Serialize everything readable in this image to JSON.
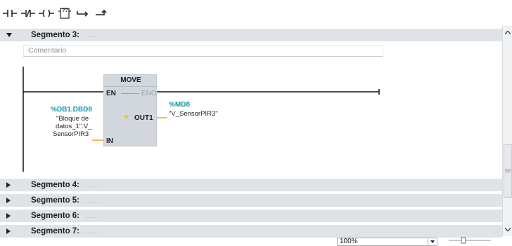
{
  "toolbar": {
    "items": [
      {
        "icon": "no-contact-icon"
      },
      {
        "icon": "nc-contact-icon"
      },
      {
        "icon": "coil-icon"
      },
      {
        "icon": "empty-box-icon",
        "label": "??"
      },
      {
        "icon": "open-branch-icon"
      },
      {
        "icon": "close-branch-icon"
      }
    ]
  },
  "segments": {
    "seg3": {
      "title": "Segmento 3:",
      "dots": "....."
    },
    "seg4": {
      "title": "Segmento 4:",
      "dots": "....."
    },
    "seg5": {
      "title": "Segmento 5:",
      "dots": "....."
    },
    "seg6": {
      "title": "Segmento 6:",
      "dots": "....."
    },
    "seg7": {
      "title": "Segmento 7:",
      "dots": "....."
    }
  },
  "network3": {
    "comment_placeholder": "Comentario",
    "move": {
      "title": "MOVE",
      "en": "EN",
      "eno": "ENO",
      "in": "IN",
      "out1": "OUT1"
    },
    "in_operand": {
      "address": "%DB1.DBD8",
      "name_line1": "\"Bloque de",
      "name_line2": "datos_1\".V_",
      "name_line3": "SensorPIR3"
    },
    "out_operand": {
      "address": "%MD8",
      "name": "\"V_SensorPIR3\""
    }
  },
  "zoom": {
    "value": "100%"
  },
  "colors": {
    "segment_header": "#dfe3e8",
    "operand_address": "#1796a3",
    "wire_orange": "#f0a020",
    "box_fill": "#d2d7de"
  }
}
